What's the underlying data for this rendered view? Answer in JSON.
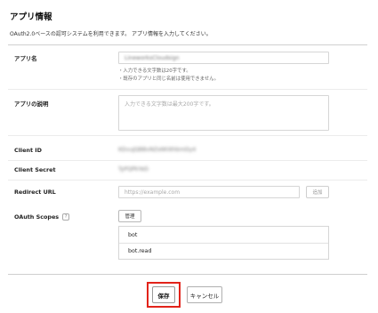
{
  "header": {
    "title": "アプリ情報",
    "description": "OAuth2.0ベースの認可システムを利用できます。 アプリ情報を入力してください。"
  },
  "form": {
    "app_name": {
      "label": "アプリ名",
      "value": "LineworksCloudsign",
      "hints": [
        "・入力できる文字数は20字です。",
        "・既存のアプリと同じ名前は使用できません。"
      ]
    },
    "app_description": {
      "label": "アプリの説明",
      "placeholder": "入力できる文字数は最大200字です。"
    },
    "client_id": {
      "label": "Client ID",
      "value": "KDvuJQBBvNZs6Ki6hbmDy4"
    },
    "client_secret": {
      "label": "Client Secret",
      "value": "TyPQPkYeD"
    },
    "redirect_url": {
      "label": "Redirect URL",
      "placeholder": "https://example.com",
      "add_button": "追加"
    },
    "oauth_scopes": {
      "label": "OAuth Scopes",
      "help_icon": "?",
      "manage_button": "管理",
      "scopes": [
        "bot",
        "bot.read"
      ]
    }
  },
  "footer": {
    "save_label": "保存",
    "cancel_label": "キャンセル",
    "highlight_color": "#e2231a"
  }
}
